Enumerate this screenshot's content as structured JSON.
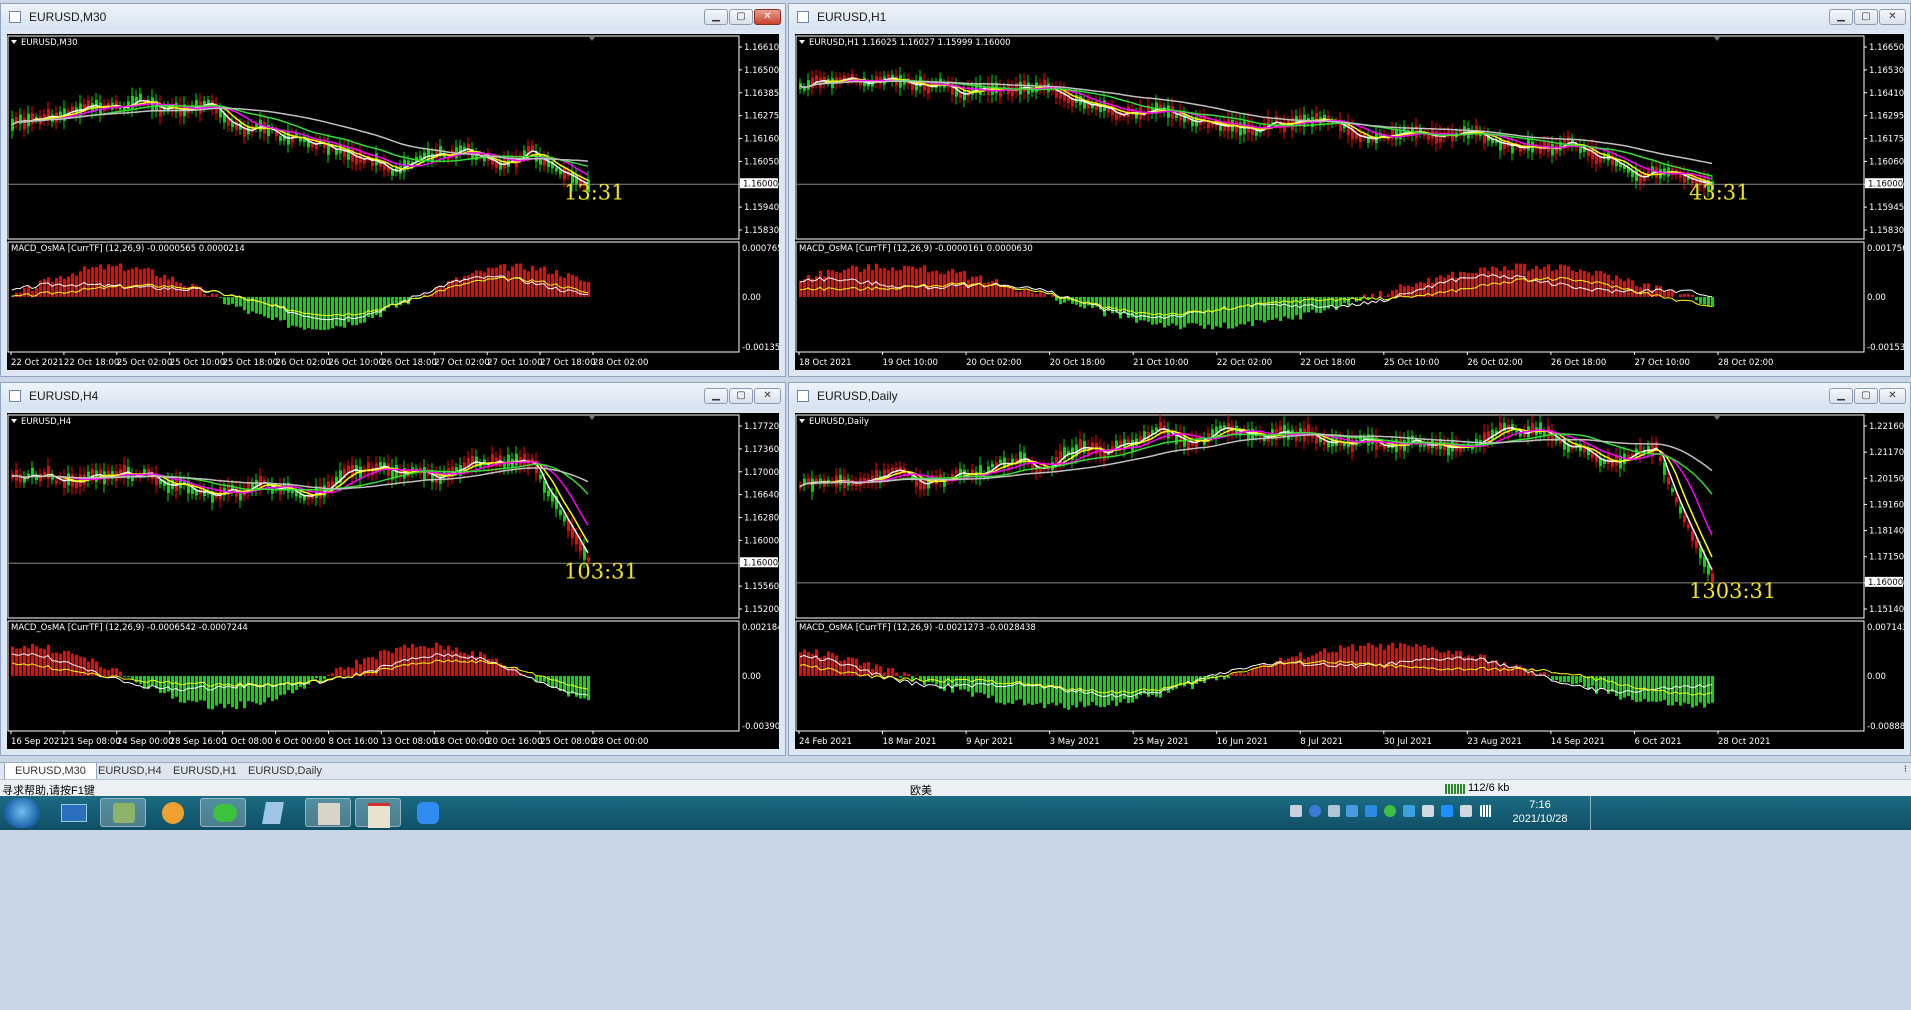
{
  "windows": [
    {
      "title": "EURUSD,M30",
      "chart_label": "EURUSD,M30",
      "ohlc": "",
      "counter": "13:31",
      "price_labels": [
        "1.16610",
        "1.16500",
        "1.16385",
        "1.16275",
        "1.16160",
        "1.16050",
        "1.16000",
        "1.15940",
        "1.15830"
      ],
      "price_marker": "1.16000",
      "macd_label": "MACD_OsMA [CurrTF] (12,26,9) -0.0000565 0.0000214",
      "macd_levels": [
        "0.0007655",
        "0.00",
        "-0.001353"
      ],
      "time_labels": [
        "22 Oct 2021",
        "22 Oct 18:00",
        "25 Oct 02:00",
        "25 Oct 10:00",
        "25 Oct 18:00",
        "26 Oct 02:00",
        "26 Oct 10:00",
        "26 Oct 18:00",
        "27 Oct 02:00",
        "27 Oct 10:00",
        "27 Oct 18:00",
        "28 Oct 02:00"
      ]
    },
    {
      "title": "EURUSD,H1",
      "chart_label": "EURUSD,H1",
      "ohlc": "1.16025 1.16027 1.15999 1.16000",
      "counter": "43:31",
      "price_labels": [
        "1.16650",
        "1.16530",
        "1.16410",
        "1.16295",
        "1.16175",
        "1.16060",
        "1.16000",
        "1.15945",
        "1.15830"
      ],
      "price_marker": "1.16000",
      "macd_label": "MACD_OsMA [CurrTF] (12,26,9) -0.0000161 0.0000630",
      "macd_levels": [
        "0.0017565",
        "0.00",
        "-0.001534"
      ],
      "time_labels": [
        "18 Oct 2021",
        "19 Oct 10:00",
        "20 Oct 02:00",
        "20 Oct 18:00",
        "21 Oct 10:00",
        "22 Oct 02:00",
        "22 Oct 18:00",
        "25 Oct 10:00",
        "26 Oct 02:00",
        "26 Oct 18:00",
        "27 Oct 10:00",
        "28 Oct 02:00"
      ]
    },
    {
      "title": "EURUSD,H4",
      "chart_label": "EURUSD,H4",
      "ohlc": "",
      "counter": "103:31",
      "price_labels": [
        "1.17720",
        "1.17360",
        "1.17000",
        "1.16640",
        "1.16280",
        "1.16000",
        "1.15920",
        "1.15560",
        "1.15200"
      ],
      "price_marker": "1.16000",
      "macd_label": "MACD_OsMA [CurrTF] (12,26,9) -0.0006542 -0.0007244",
      "macd_levels": [
        "0.0021845",
        "0.00",
        "-0.003903"
      ],
      "time_labels": [
        "16 Sep 2021",
        "21 Sep 08:00",
        "24 Sep 00:00",
        "28 Sep 16:00",
        "1 Oct 08:00",
        "6 Oct 00:00",
        "8 Oct 16:00",
        "13 Oct 08:00",
        "18 Oct 00:00",
        "20 Oct 16:00",
        "25 Oct 08:00",
        "28 Oct 00:00"
      ]
    },
    {
      "title": "EURUSD,Daily",
      "chart_label": "EURUSD,Daily",
      "ohlc": "",
      "counter": "1303:31",
      "price_labels": [
        "1.22160",
        "1.21170",
        "1.20150",
        "1.19160",
        "1.18140",
        "1.17150",
        "1.16000",
        "1.15140"
      ],
      "price_marker": "1.16000",
      "macd_label": "MACD_OsMA [CurrTF] (12,26,9) -0.0021273 -0.0028438",
      "macd_levels": [
        "0.0071439",
        "0.00",
        "-0.008882"
      ],
      "time_labels": [
        "24 Feb 2021",
        "18 Mar 2021",
        "9 Apr 2021",
        "3 May 2021",
        "25 May 2021",
        "16 Jun 2021",
        "8 Jul 2021",
        "30 Jul 2021",
        "23 Aug 2021",
        "14 Sep 2021",
        "6 Oct 2021",
        "28 Oct 2021"
      ]
    }
  ],
  "tabs": [
    "EURUSD,M30",
    "EURUSD,H4",
    "EURUSD,H1",
    "EURUSD,Daily"
  ],
  "active_tab": "EURUSD,M30",
  "status": {
    "help": "寻求帮助,请按F1键",
    "profile": "欧美",
    "traffic": "112/6 kb"
  },
  "clock": {
    "time": "7:16",
    "date": "2021/10/28"
  },
  "colors": {
    "bull": "#ff0000",
    "bear": "#00e000",
    "ma_fast": "#ffffff",
    "ma_yellow": "#ffff00",
    "ma_magenta": "#ff00ff",
    "ma_green": "#33dd33",
    "ma_gray": "#c0c0c0",
    "counter": "#f0e21e"
  }
}
